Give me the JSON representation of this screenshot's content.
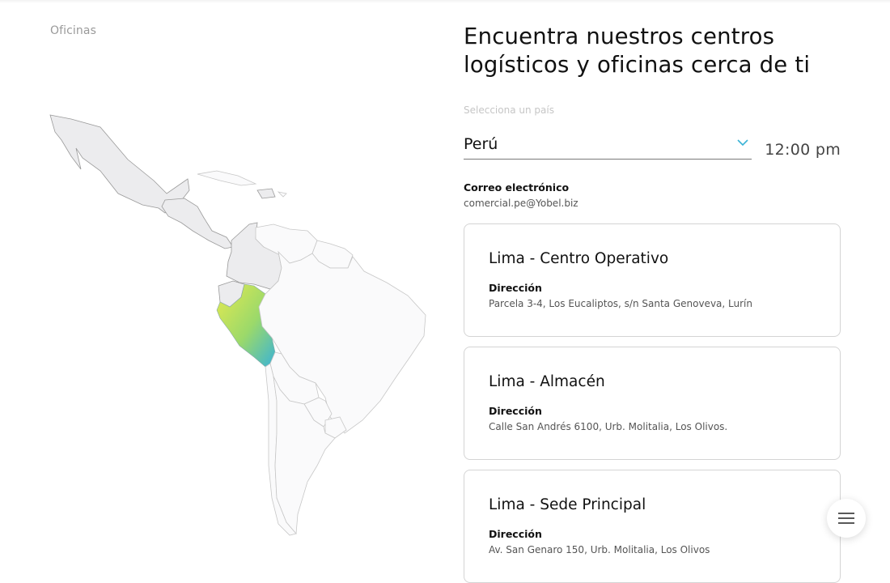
{
  "breadcrumb": "Oficinas",
  "title": "Encuentra nuestros centros logísticos y oficinas cerca de ti",
  "country_select": {
    "label": "Selecciona un país",
    "value": "Perú",
    "icon": "chevron-down-icon"
  },
  "clock": "12:00 pm",
  "contact": {
    "email_label": "Correo electrónico",
    "email": "comercial.pe@Yobel.biz"
  },
  "offices": [
    {
      "name": "Lima - Centro Operativo",
      "address_label": "Dirección",
      "address": "Parcela 3-4, Los Eucaliptos, s/n Santa Genoveva, Lurín"
    },
    {
      "name": "Lima - Almacén",
      "address_label": "Dirección",
      "address": "Calle San Andrés 6100, Urb. Molitalia, Los Olivos."
    },
    {
      "name": "Lima - Sede Principal",
      "address_label": "Dirección",
      "address": "Av. San Genaro 150, Urb. Molitalia, Los Olivos"
    }
  ],
  "map": {
    "highlight_gradient": [
      "#e6ea4f",
      "#6fcf97",
      "#3ab3d6"
    ],
    "active_fill": "#ececee",
    "inactive_fill": "#fafafb"
  },
  "menu_icon": "hamburger-menu-icon"
}
